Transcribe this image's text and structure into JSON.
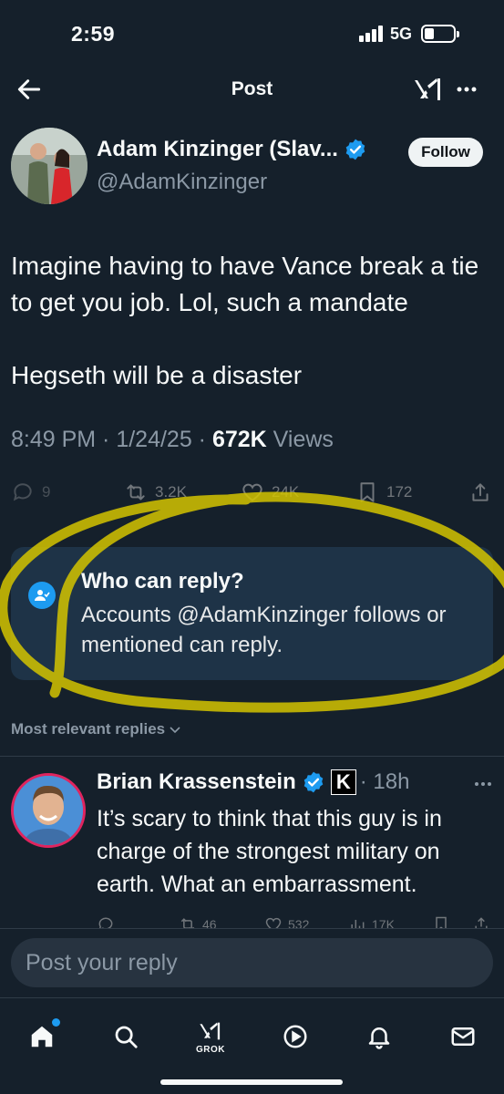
{
  "status_bar": {
    "time": "2:59",
    "network": "5G"
  },
  "header": {
    "title": "Post"
  },
  "post": {
    "author_name": "Adam Kinzinger (Slav...",
    "author_handle": "@AdamKinzinger",
    "follow_label": "Follow",
    "text_line1": "Imagine having to have Vance break a tie to get you job.  Lol, such a mandate",
    "text_line2": "Hegseth will be a disaster",
    "time": "8:49 PM · 1/24/25 · ",
    "views_count": "672K",
    "views_label": " Views",
    "stats": {
      "replies": "9",
      "reposts": "3.2K",
      "likes": "24K",
      "bookmarks": "172"
    }
  },
  "reply_restriction": {
    "title": "Who can reply?",
    "text": "Accounts @AdamKinzinger follows or mentioned can reply."
  },
  "sort_label": "Most relevant replies",
  "reply": {
    "author_name": "Brian Krassenstein",
    "badge_letter": "K",
    "time": "· 18h",
    "text": "It’s scary to think that this guy is in charge of the strongest military on earth.  What an embarrassment.",
    "stats": {
      "reposts": "46",
      "likes": "532",
      "views": "17K"
    }
  },
  "composer": {
    "placeholder": "Post your reply"
  },
  "bottom_nav": {
    "grok_label": "GROK"
  },
  "colors": {
    "background": "#15202b",
    "accent": "#1d9bf0",
    "highlight": "#d4c400"
  }
}
